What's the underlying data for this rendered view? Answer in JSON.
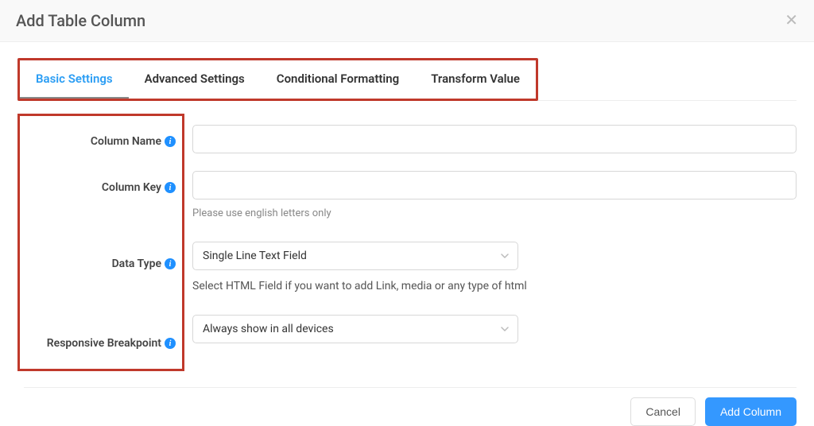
{
  "header": {
    "title": "Add Table Column"
  },
  "tabs": {
    "items": [
      {
        "label": "Basic Settings",
        "active": true
      },
      {
        "label": "Advanced Settings",
        "active": false
      },
      {
        "label": "Conditional Formatting",
        "active": false
      },
      {
        "label": "Transform Value",
        "active": false
      }
    ]
  },
  "form": {
    "column_name": {
      "label": "Column Name",
      "value": ""
    },
    "column_key": {
      "label": "Column Key",
      "value": "",
      "helper": "Please use english letters only"
    },
    "data_type": {
      "label": "Data Type",
      "value": "Single Line Text Field",
      "helper": "Select HTML Field if you want to add Link, media or any type of html"
    },
    "responsive": {
      "label": "Responsive Breakpoint",
      "value": "Always show in all devices"
    }
  },
  "footer": {
    "cancel_label": "Cancel",
    "submit_label": "Add Column"
  },
  "icons": {
    "info": "i"
  }
}
